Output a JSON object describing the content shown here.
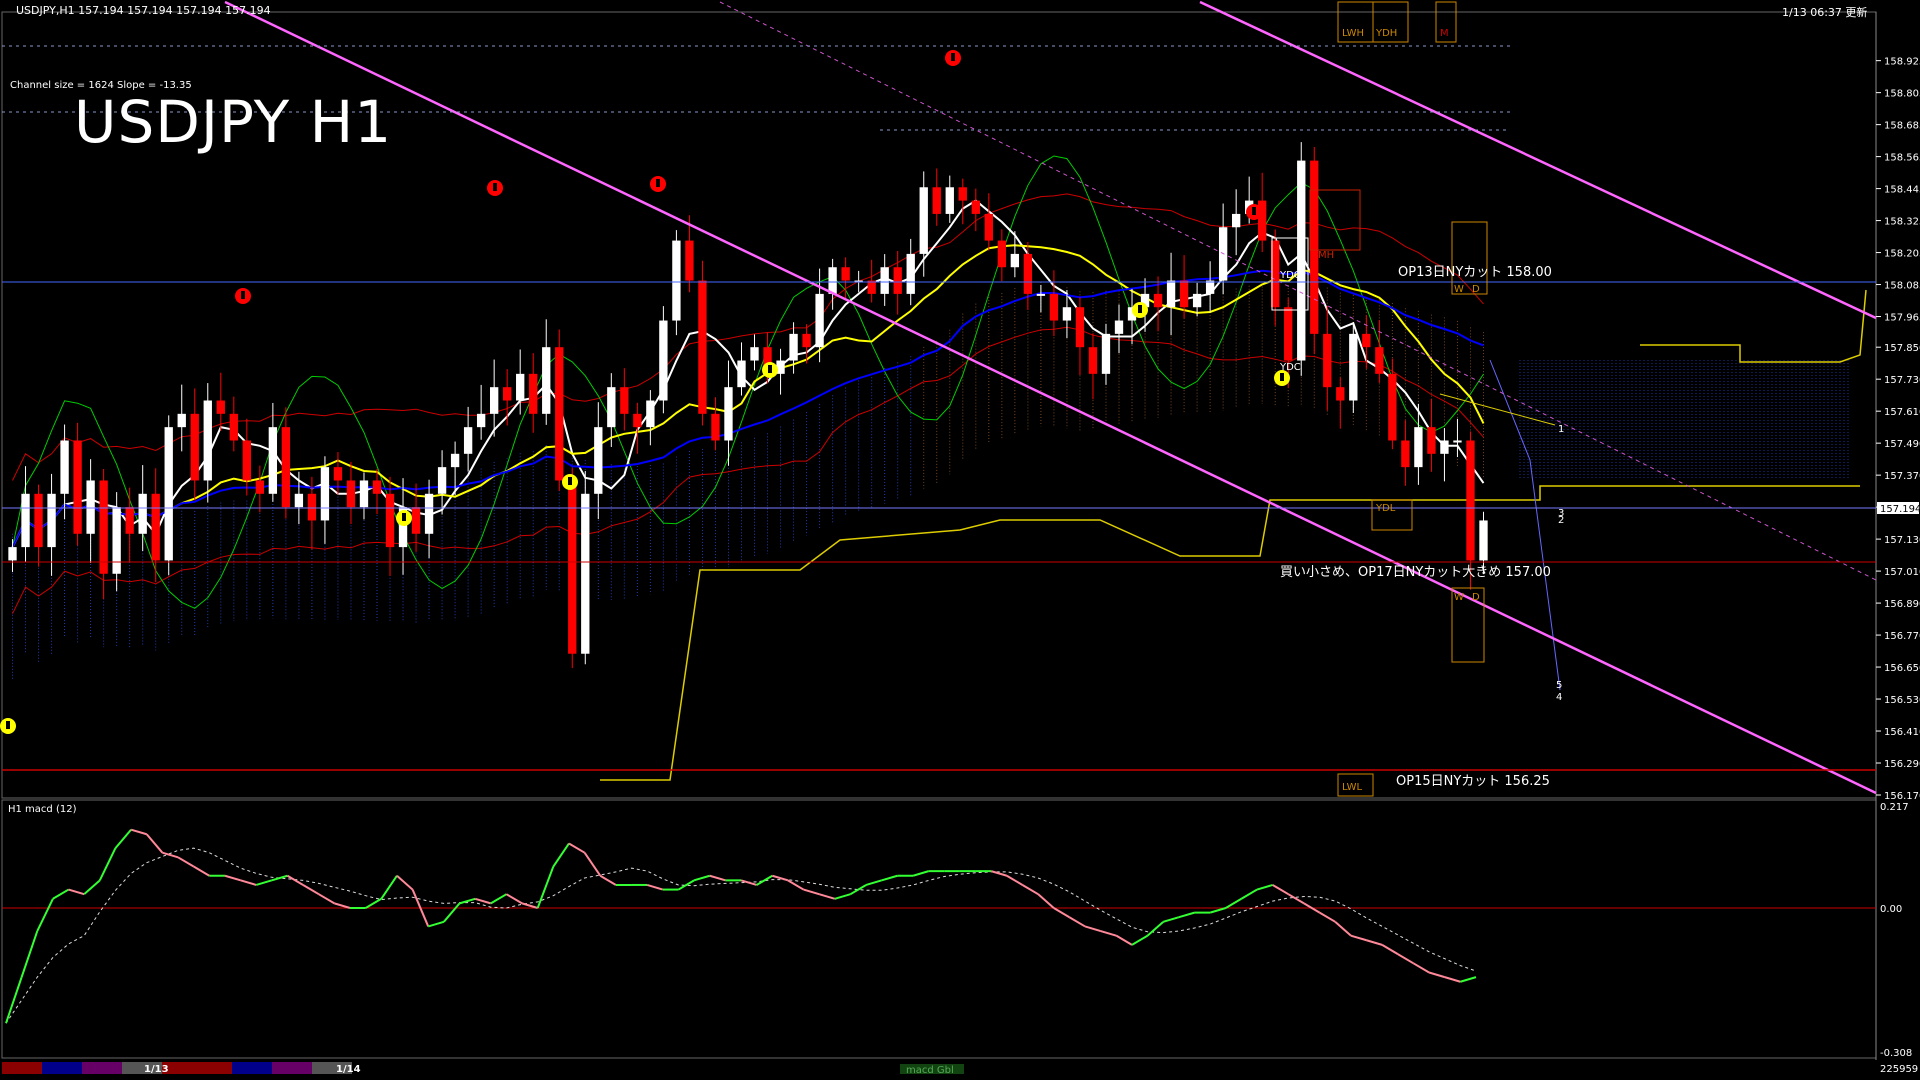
{
  "header": {
    "symbol_info": "USDJPY,H1  157.194 157.194 157.194 157.194",
    "timestamp": "1/13 06:37 更新",
    "channel_info": "Channel size = 1624 Slope = -13.35",
    "big_title": "USDJPY H1"
  },
  "colors": {
    "bullish": "#ffffff",
    "bearish": "#ff0000",
    "ma_white": "#ffffff",
    "ma_yellow": "#ffff00",
    "ma_blue": "#0000ff",
    "channel": "#ff66ff",
    "macd_up": "#33ff33",
    "macd_down": "#ff8899",
    "cloud": "#3355ff"
  },
  "annotations": {
    "op13": "OP13日NYカット 158.00",
    "op17": "買い小さめ、OP17日NYカット大きめ 157.00",
    "op15": "OP15日NYカット 156.25",
    "ydo": "YDO",
    "ydc": "YDC",
    "ydl": "YDL",
    "lwh": "LWH",
    "ydh": "YDH",
    "lwl": "LWL",
    "mh": "MH",
    "m": "M",
    "w": "W",
    "d": "D",
    "lvl1": "1",
    "lvl2": "2",
    "lvl3": "3",
    "lvl4": "4",
    "lvl5": "5"
  },
  "macd_label": "H1 macd (12)",
  "macd_axis": {
    "top": "0.217",
    "zero": "0.00",
    "bottom": "-0.308"
  },
  "footer": {
    "date1": "1/13",
    "date2": "1/14",
    "center": "macd Gbl",
    "right": "225959"
  },
  "chart_data": {
    "type": "candlestick",
    "symbol": "USDJPY",
    "timeframe": "H1",
    "ylim": [
      156.17,
      159.04
    ],
    "y_ticks": [
      158.925,
      158.805,
      158.685,
      158.565,
      158.445,
      158.325,
      158.205,
      158.085,
      157.965,
      157.85,
      157.73,
      157.61,
      157.49,
      157.37,
      157.25,
      157.13,
      157.01,
      156.89,
      156.77,
      156.65,
      156.53,
      156.41,
      156.29,
      156.17
    ],
    "current_price": 157.194,
    "levels": [
      {
        "name": "op13",
        "price": 158.0
      },
      {
        "name": "op17",
        "price": 157.0
      },
      {
        "name": "op15",
        "price": 156.25
      }
    ],
    "close": [
      157.1,
      157.3,
      157.1,
      157.3,
      157.5,
      157.15,
      157.35,
      157.0,
      157.25,
      157.15,
      157.3,
      157.05,
      157.55,
      157.6,
      157.35,
      157.65,
      157.6,
      157.5,
      157.35,
      157.3,
      157.55,
      157.25,
      157.3,
      157.2,
      157.4,
      157.35,
      157.25,
      157.35,
      157.3,
      157.1,
      157.25,
      157.15,
      157.3,
      157.4,
      157.45,
      157.55,
      157.6,
      157.7,
      157.65,
      157.75,
      157.6,
      157.85,
      157.35,
      156.7,
      157.3,
      157.55,
      157.7,
      157.6,
      157.55,
      157.65,
      157.95,
      158.25,
      158.1,
      157.6,
      157.5,
      157.7,
      157.8,
      157.85,
      157.75,
      157.8,
      157.9,
      157.85,
      158.05,
      158.15,
      158.1,
      158.1,
      158.05,
      158.15,
      158.05,
      158.2,
      158.45,
      158.35,
      158.45,
      158.4,
      158.35,
      158.25,
      158.15,
      158.2,
      158.05,
      158.05,
      157.95,
      158.0,
      157.85,
      157.75,
      157.9,
      157.95,
      158.0,
      158.05,
      158.0,
      158.1,
      158.0,
      158.05,
      158.1,
      158.3,
      158.35,
      158.4,
      158.25,
      158.0,
      157.8,
      158.55,
      157.9,
      157.7,
      157.65,
      157.9,
      157.85,
      157.75,
      157.5,
      157.4,
      157.55,
      157.45,
      157.5,
      157.5,
      157.05,
      157.2
    ],
    "macd": [
      -0.25,
      -0.15,
      -0.05,
      0.02,
      0.04,
      0.03,
      0.06,
      0.13,
      0.17,
      0.16,
      0.12,
      0.11,
      0.09,
      0.07,
      0.07,
      0.06,
      0.05,
      0.06,
      0.07,
      0.05,
      0.03,
      0.01,
      0.0,
      0.0,
      0.02,
      0.07,
      0.04,
      -0.04,
      -0.03,
      0.01,
      0.02,
      0.01,
      0.03,
      0.01,
      0.0,
      0.09,
      0.14,
      0.12,
      0.07,
      0.05,
      0.05,
      0.05,
      0.04,
      0.04,
      0.06,
      0.07,
      0.06,
      0.06,
      0.05,
      0.07,
      0.06,
      0.04,
      0.03,
      0.02,
      0.03,
      0.05,
      0.06,
      0.07,
      0.07,
      0.08,
      0.08,
      0.08,
      0.08,
      0.08,
      0.07,
      0.05,
      0.03,
      0.0,
      -0.02,
      -0.04,
      -0.05,
      -0.06,
      -0.08,
      -0.06,
      -0.03,
      -0.02,
      -0.01,
      -0.01,
      0.0,
      0.02,
      0.04,
      0.05,
      0.03,
      0.01,
      -0.01,
      -0.03,
      -0.06,
      -0.07,
      -0.08,
      -0.1,
      -0.12,
      -0.14,
      -0.15,
      -0.16,
      -0.15
    ]
  }
}
